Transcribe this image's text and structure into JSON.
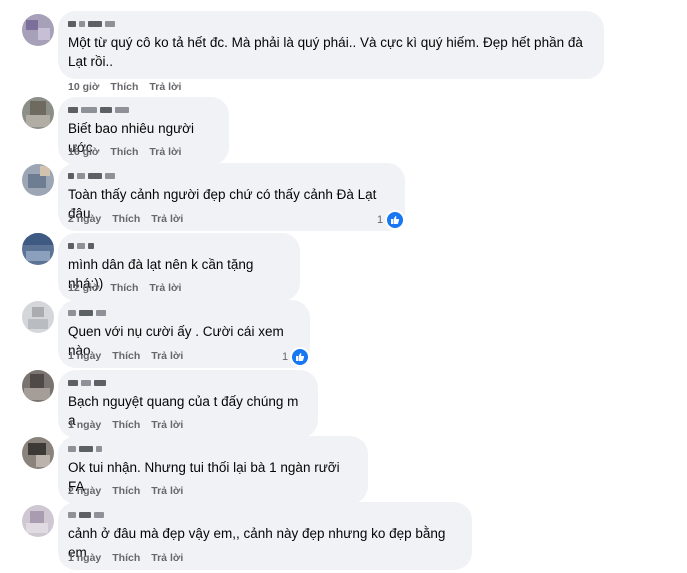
{
  "colors": {
    "bubble": "#f0f2f5",
    "meta_text": "#65676b",
    "like_blue": "#1877f2"
  },
  "icons": {
    "reaction": "like-thumb-icon"
  },
  "comments": [
    {
      "text": "Một từ quý cô ko tả hết đc. Mà phải là quý phái.. Và cực kì quý hiếm. Đẹp hết phần đà Lạt rồi..",
      "time": "10 giờ",
      "like": "Thích",
      "reply": "Trả lời",
      "reactions": ""
    },
    {
      "text": "Biết bao nhiêu người ước",
      "time": "16 giờ",
      "like": "Thích",
      "reply": "Trả lời",
      "reactions": ""
    },
    {
      "text": "Toàn thấy cảnh người đẹp chứ có thấy cảnh Đà Lạt đâu",
      "time": "2 ngày",
      "like": "Thích",
      "reply": "Trả lời",
      "reactions": "1"
    },
    {
      "text": "mình dân đà lạt nên k cần tặng nhá:))",
      "time": "12 giờ",
      "like": "Thích",
      "reply": "Trả lời",
      "reactions": ""
    },
    {
      "text": "Quen với nụ cười ấy . Cười cái xem nào",
      "time": "1 ngày",
      "like": "Thích",
      "reply": "Trả lời",
      "reactions": "1"
    },
    {
      "text": "Bạch nguyệt quang của t đấy chúng m ạ",
      "time": "1 ngày",
      "like": "Thích",
      "reply": "Trả lời",
      "reactions": ""
    },
    {
      "text": "Ok tui nhận. Nhưng tui thối lại bà 1 ngàn rưỡi FA",
      "time": "2 ngày",
      "like": "Thích",
      "reply": "Trả lời",
      "reactions": ""
    },
    {
      "text": "cảnh ở đâu mà đẹp vậy em,, cảnh này đẹp nhưng ko đẹp bằng em",
      "time": "1 ngày",
      "like": "Thích",
      "reply": "Trả lời",
      "reactions": ""
    }
  ]
}
